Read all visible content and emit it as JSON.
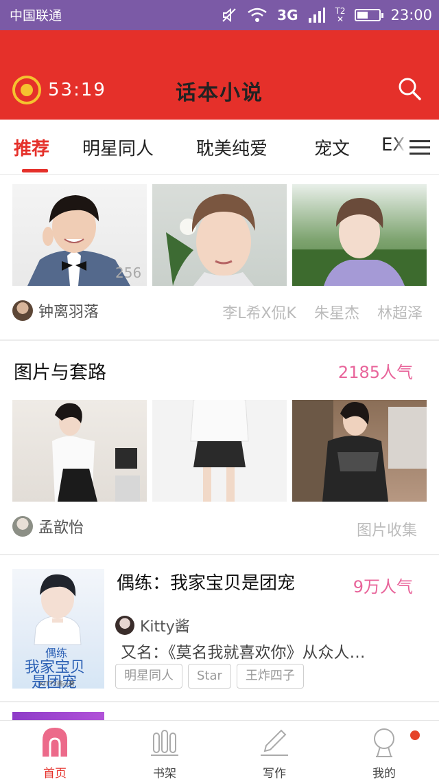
{
  "status_bar": {
    "carrier": "中国联通",
    "network": "3G",
    "time": "23:00",
    "battery_level_percent": 50
  },
  "header": {
    "timer": "53:19",
    "title": "话本小说",
    "icons": [
      "alarm-clock-icon",
      "search-icon"
    ]
  },
  "tabs": [
    {
      "label": "推荐",
      "active": true
    },
    {
      "label": "明星同人",
      "active": false
    },
    {
      "label": "耽美纯爱",
      "active": false
    },
    {
      "label": "宠文",
      "active": false
    },
    {
      "label": "EX(",
      "active": false
    }
  ],
  "card1": {
    "author": "钟离羽落",
    "tags": [
      "李L希X侃K",
      "朱星杰",
      "林超泽"
    ],
    "image_watermark": "256"
  },
  "card2": {
    "title": "图片与套路",
    "popularity": "2185人气",
    "author": "孟歆怡",
    "tag": "图片收集"
  },
  "novel": {
    "title": "偶练：我家宝贝是团宠",
    "popularity": "9万人气",
    "author": "Kitty酱",
    "description": "又名：《莫名我就喜欢你》从众人…",
    "tags": [
      "明星同人",
      "Star",
      "王炸四子"
    ],
    "cover_text": [
      "偶练",
      "我家宝贝",
      "是团宠"
    ],
    "cover_author": "KITTY酱◎著"
  },
  "bottom_nav": [
    {
      "label": "首页",
      "icon": "home-icon",
      "active": true
    },
    {
      "label": "书架",
      "icon": "bookshelf-icon",
      "active": false
    },
    {
      "label": "写作",
      "icon": "pen-icon",
      "active": false
    },
    {
      "label": "我的",
      "icon": "profile-icon",
      "active": false,
      "badge": true
    }
  ]
}
